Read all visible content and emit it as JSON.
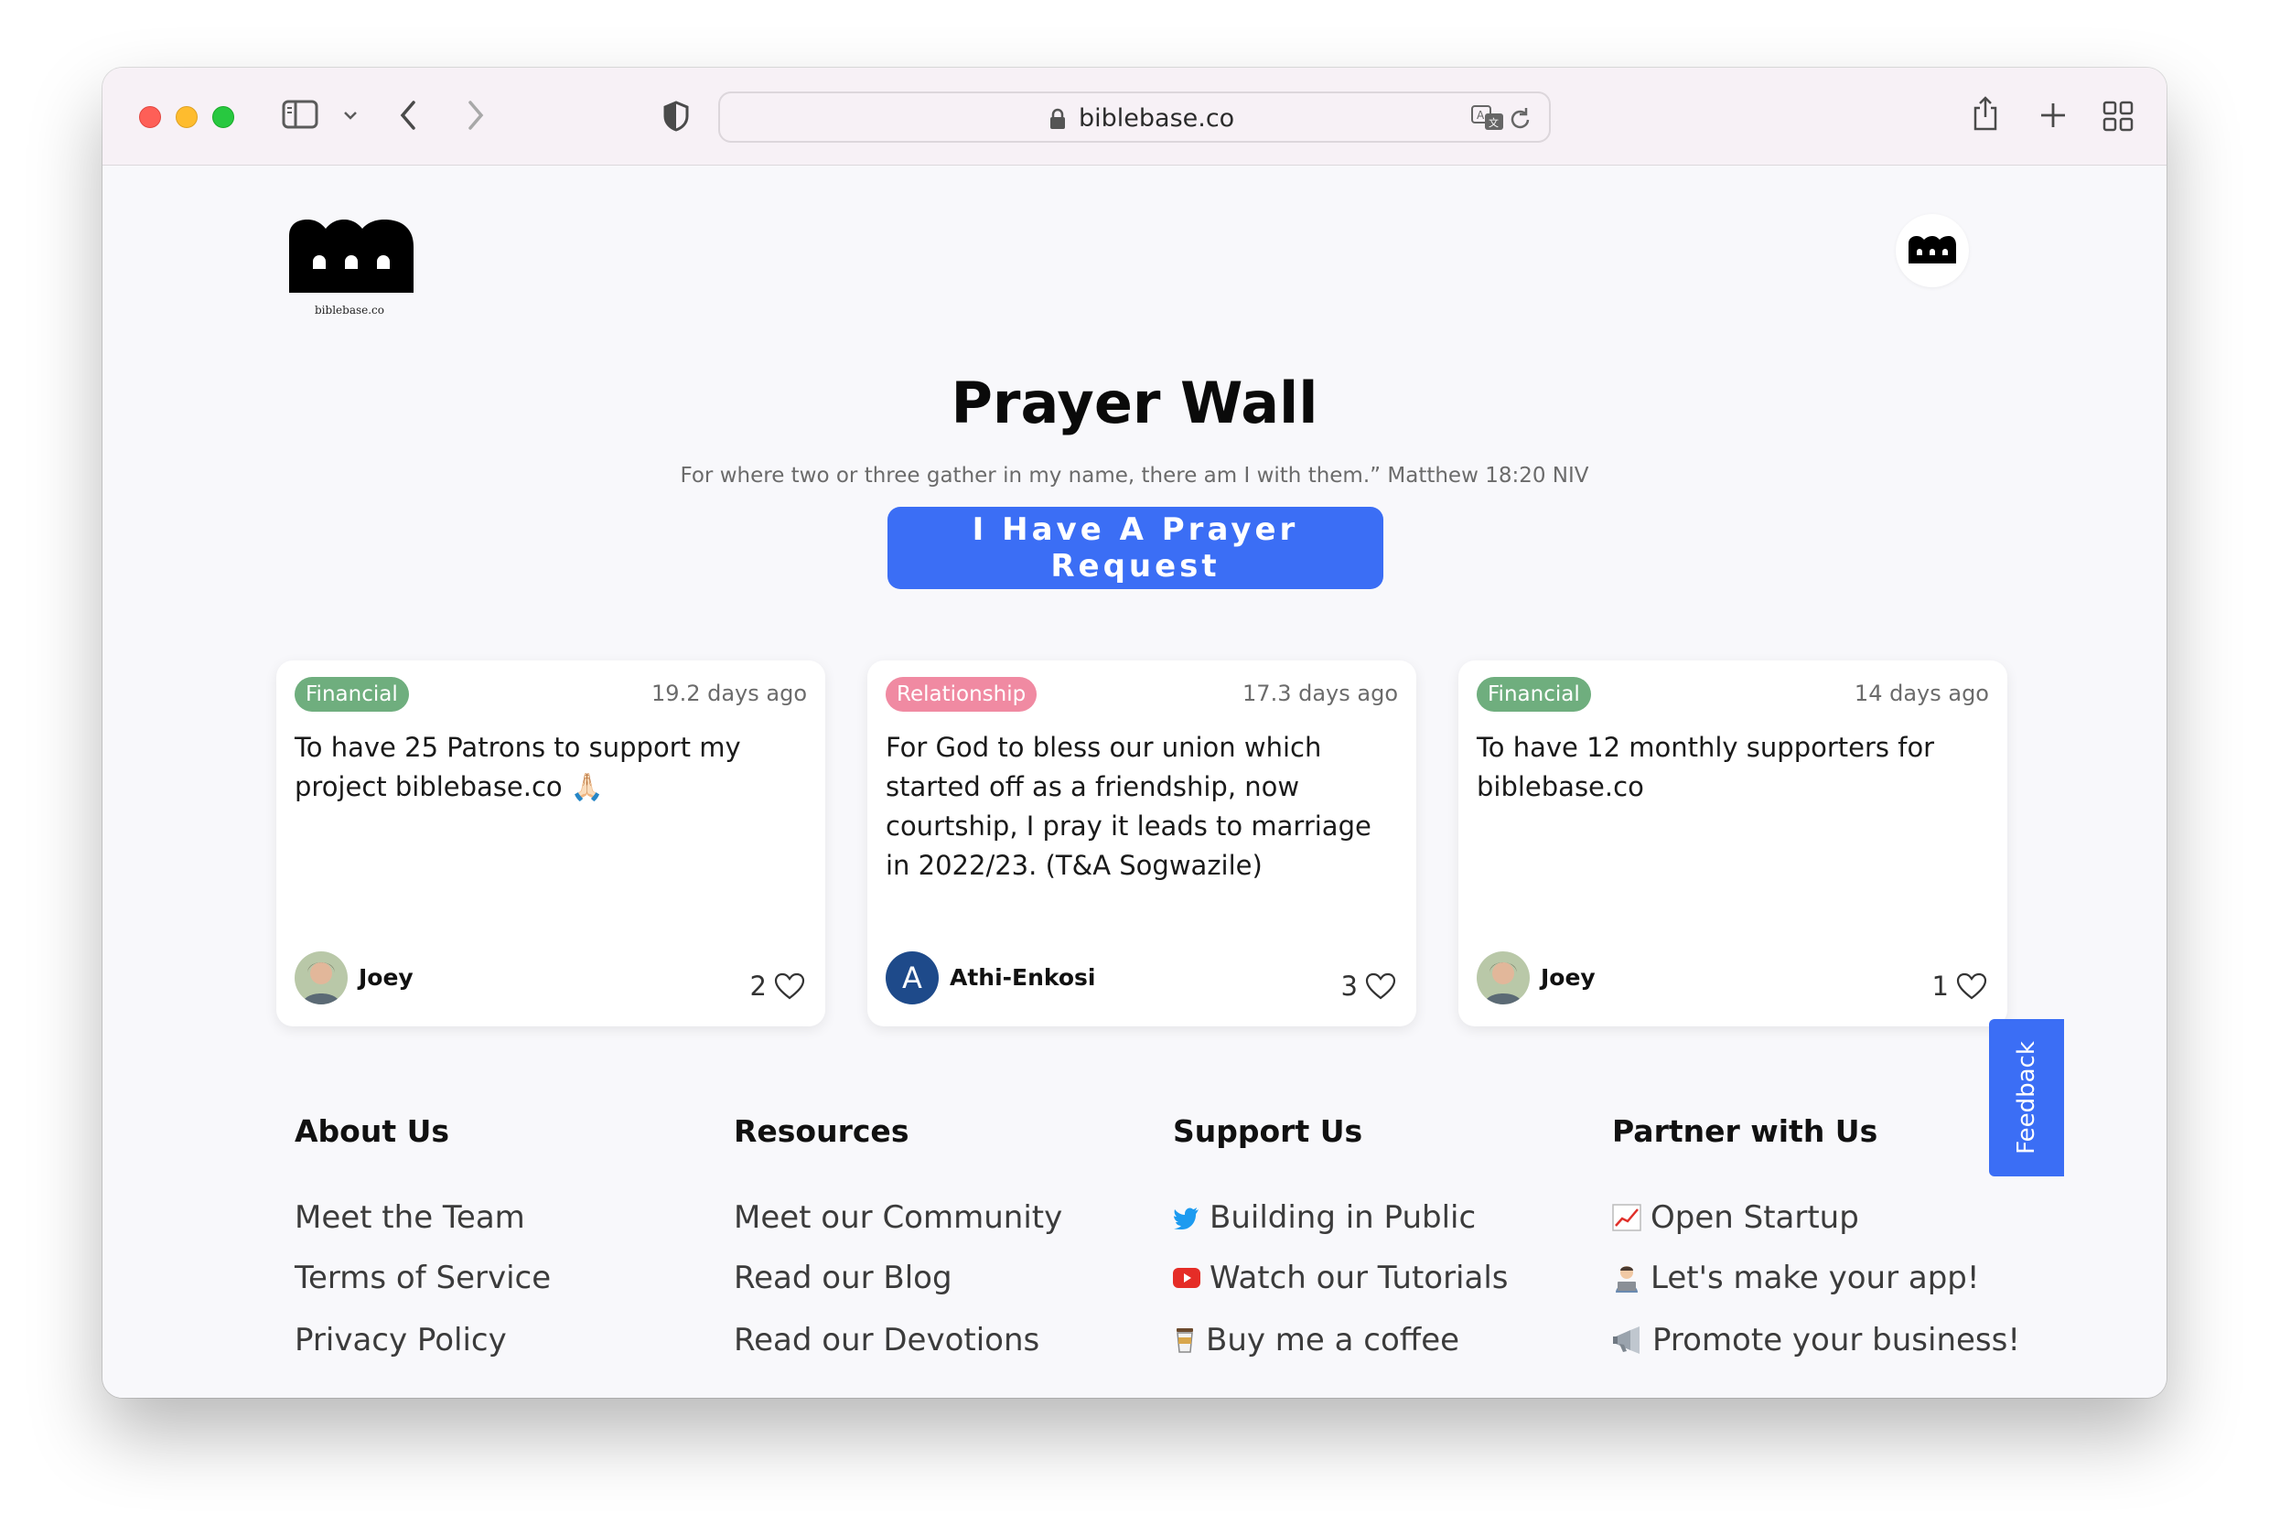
{
  "browser": {
    "url": "biblebase.co"
  },
  "site": {
    "logo_caption": "biblebase.co",
    "title": "Prayer Wall",
    "verse": "For where two or three gather in my name, there am I with them.” Matthew 18:20 NIV",
    "cta_label": "I Have A Prayer Request"
  },
  "cards": [
    {
      "category": "Financial",
      "category_color": "#6fae7e",
      "time": "19.2 days ago",
      "text": "To have 25 Patrons to support my project biblebase.co 🙏🏻",
      "author": "Joey",
      "likes": "2"
    },
    {
      "category": "Relationship",
      "category_color": "#f08aa2",
      "time": "17.3 days ago",
      "text": "For God to bless our union which started off as a friendship, now courtship, I pray it leads to marriage in 2022/23. (T&A Sogwazile)",
      "author": "Athi-Enkosi",
      "author_initial": "A",
      "likes": "3"
    },
    {
      "category": "Financial",
      "category_color": "#6fae7e",
      "time": "14 days ago",
      "text": "To have 12 monthly supporters for biblebase.co",
      "author": "Joey",
      "likes": "1"
    }
  ],
  "footer": {
    "about": {
      "heading": "About Us",
      "links": [
        "Meet the Team",
        "Terms of Service",
        "Privacy Policy"
      ]
    },
    "resources": {
      "heading": "Resources",
      "links": [
        "Meet our Community",
        "Read our Blog",
        "Read our Devotions"
      ]
    },
    "support": {
      "heading": "Support Us",
      "links": [
        "Building in Public",
        "Watch our Tutorials",
        "Buy me a coffee"
      ],
      "icons": [
        "twitter-icon",
        "youtube-icon",
        "coffee-icon"
      ]
    },
    "partner": {
      "heading": "Partner with Us",
      "links": [
        "Open Startup",
        "Let's make your app!",
        "Promote your business!"
      ],
      "icons": [
        "chart-icon",
        "technologist-icon",
        "megaphone-icon"
      ]
    }
  },
  "feedback_label": "Feedback",
  "colors": {
    "accent": "#3b6ef5",
    "financial": "#6fae7e",
    "relationship": "#f08aa2"
  }
}
